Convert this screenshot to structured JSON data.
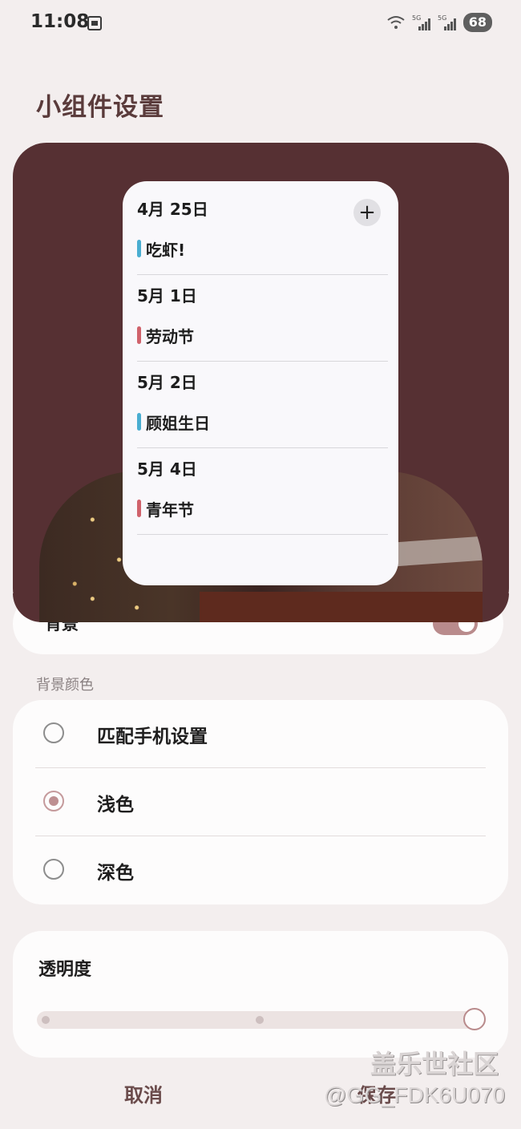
{
  "status": {
    "time": "11:08",
    "battery": "68",
    "net1": "5G",
    "net2": "5G"
  },
  "title": "小组件设置",
  "calendar": {
    "add_label": "+",
    "groups": [
      {
        "date": "4月 25日",
        "event": "吃虾!",
        "color": "#4aaed1"
      },
      {
        "date": "5月 1日",
        "event": "劳动节",
        "color": "#d0626b"
      },
      {
        "date": "5月 2日",
        "event": "顾姐生日",
        "color": "#4aaed1"
      },
      {
        "date": "5月 4日",
        "event": "青年节",
        "color": "#d0626b"
      }
    ]
  },
  "background_row": {
    "label": "背景",
    "enabled": true
  },
  "bg_color_section": {
    "label": "背景颜色",
    "options": [
      {
        "label": "匹配手机设置",
        "selected": false
      },
      {
        "label": "浅色",
        "selected": true
      },
      {
        "label": "深色",
        "selected": false
      }
    ]
  },
  "transparency": {
    "label": "透明度",
    "value": 1.0
  },
  "actions": {
    "cancel": "取消",
    "save": "保存"
  },
  "watermark": {
    "line1": "盖乐世社区",
    "line2": "@GG_FDK6U070"
  },
  "colors": {
    "accent": "#b98b8c",
    "preview_bg": "#563033",
    "title": "#5a3b3b"
  }
}
